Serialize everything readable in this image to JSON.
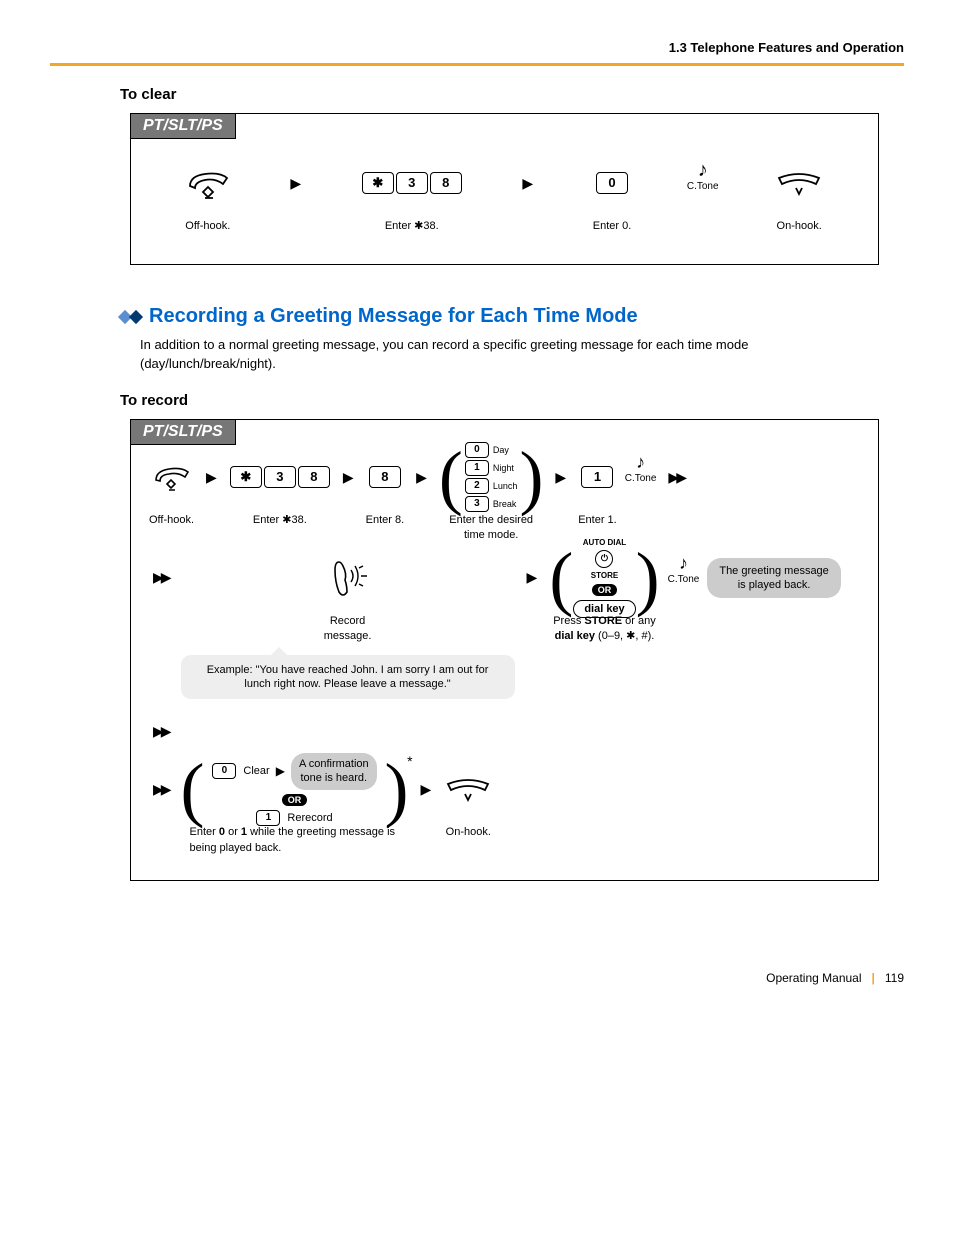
{
  "header": {
    "breadcrumb": "1.3 Telephone Features and Operation"
  },
  "sub1": "To clear",
  "panel1": {
    "tab": "PT/SLT/PS",
    "s1_label": "Off-hook.",
    "s2_k1": "✱",
    "s2_k2": "3",
    "s2_k3": "8",
    "s2_label": "Enter ✱38.",
    "s3_k": "0",
    "s3_label": "Enter 0.",
    "s4_label": "C.Tone",
    "s5_label": "On-hook."
  },
  "section": {
    "title": "Recording a Greeting Message for Each Time Mode",
    "body": "In addition to a normal greeting message, you can record a specific greeting message for each time mode (day/lunch/break/night)."
  },
  "sub2": "To record",
  "panel2": {
    "tab": "PT/SLT/PS",
    "r1": {
      "offhook": "Off-hook.",
      "k38_1": "✱",
      "k38_2": "3",
      "k38_3": "8",
      "k38_label": "Enter ✱38.",
      "k8": "8",
      "k8_label": "Enter 8.",
      "mode0": "0",
      "mode0t": "Day",
      "mode1": "1",
      "mode1t": "Night",
      "mode2": "2",
      "mode2t": "Lunch",
      "mode3": "3",
      "mode3t": "Break",
      "mode_label": "Enter the desired time mode.",
      "k1": "1",
      "k1_label": "Enter 1.",
      "ctone": "C.Tone"
    },
    "r2": {
      "rec_label": "Record message.",
      "auto": "AUTO DIAL",
      "store": "STORE",
      "or": "OR",
      "dial": "dial key",
      "store_label_a": "Press ",
      "store_label_b": "STORE",
      "store_label_c": " or any ",
      "store_label_d": "dial key",
      "store_label_e": " (0–9, ✱, #).",
      "ctone": "C.Tone",
      "pill_a": "The greeting message",
      "pill_b": "is played back.",
      "speech": "Example: \"You have reached John. I am sorry I am out for lunch right now. Please leave a message.\""
    },
    "r3": {
      "k0": "0",
      "clear": "Clear",
      "conf_a": "A confirmation",
      "conf_b": "tone is heard.",
      "or": "OR",
      "k1": "1",
      "rerec": "Rerecord",
      "opt_label_a": "Enter ",
      "opt_label_b": "0",
      "opt_label_c": " or ",
      "opt_label_d": "1",
      "opt_label_e": " while the greeting message is being played back.",
      "onhook": "On-hook."
    }
  },
  "footer": {
    "manual": "Operating Manual",
    "page": "119"
  }
}
